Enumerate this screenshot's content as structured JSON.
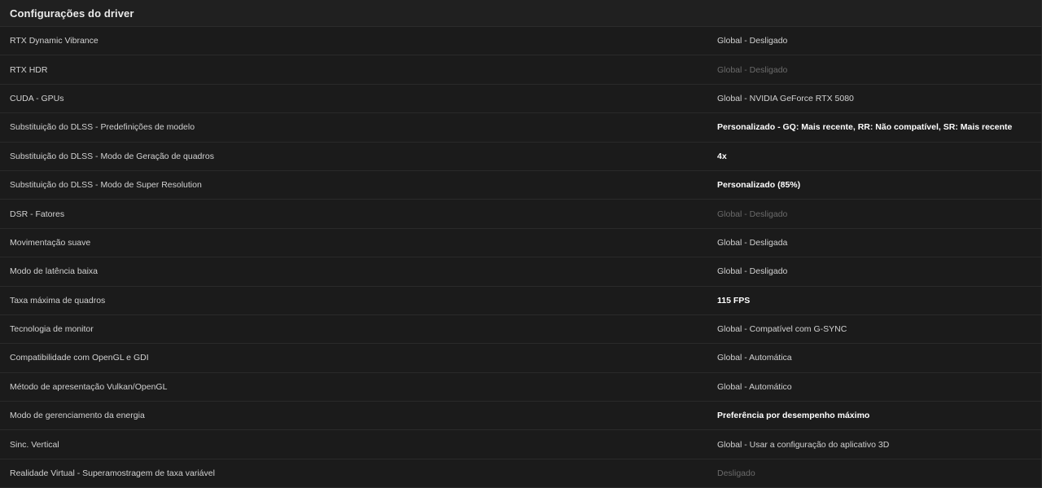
{
  "panel": {
    "title": "Configurações do driver"
  },
  "colors": {
    "background": "#1b1b1b",
    "header": "#202020",
    "divider": "#2a2a2a",
    "text": "#d2d2d2",
    "dim_text": "#6b6b6b",
    "bold_text": "#ffffff"
  },
  "rows": [
    {
      "label": "RTX Dynamic Vibrance",
      "value": "Global - Desligado",
      "style": "normal"
    },
    {
      "label": "RTX HDR",
      "value": "Global - Desligado",
      "style": "dim"
    },
    {
      "label": "CUDA - GPUs",
      "value": "Global - NVIDIA GeForce RTX 5080",
      "style": "normal"
    },
    {
      "label": "Substituição do DLSS - Predefinições de modelo",
      "value": "Personalizado - GQ: Mais recente, RR: Não compatível, SR: Mais recente",
      "style": "bold"
    },
    {
      "label": "Substituição do DLSS - Modo de Geração de quadros",
      "value": "4x",
      "style": "bold"
    },
    {
      "label": "Substituição do DLSS - Modo de Super Resolution",
      "value": "Personalizado (85%)",
      "style": "bold"
    },
    {
      "label": "DSR - Fatores",
      "value": "Global - Desligado",
      "style": "dim"
    },
    {
      "label": "Movimentação suave",
      "value": "Global - Desligada",
      "style": "normal"
    },
    {
      "label": "Modo de latência baixa",
      "value": "Global - Desligado",
      "style": "normal"
    },
    {
      "label": "Taxa máxima de quadros",
      "value": "115 FPS",
      "style": "bold"
    },
    {
      "label": "Tecnologia de monitor",
      "value": "Global - Compatível com G-SYNC",
      "style": "normal"
    },
    {
      "label": "Compatibilidade com OpenGL e GDI",
      "value": "Global - Automática",
      "style": "normal"
    },
    {
      "label": "Método de apresentação Vulkan/OpenGL",
      "value": "Global - Automático",
      "style": "normal"
    },
    {
      "label": "Modo de gerenciamento da energia",
      "value": "Preferência por desempenho máximo",
      "style": "bold"
    },
    {
      "label": "Sinc. Vertical",
      "value": "Global - Usar a configuração do aplicativo 3D",
      "style": "normal"
    },
    {
      "label": "Realidade Virtual - Superamostragem de taxa variável",
      "value": "Desligado",
      "style": "dim"
    }
  ]
}
